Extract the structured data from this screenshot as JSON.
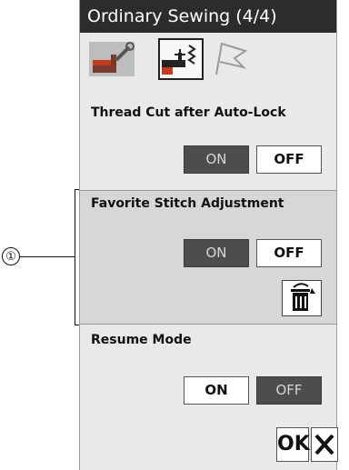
{
  "title": "Ordinary Sewing (4/4)",
  "tabs": [
    {
      "icon": "wrench-machine-icon"
    },
    {
      "icon": "stitch-machine-icon"
    },
    {
      "icon": "flag-icon"
    }
  ],
  "sections": [
    {
      "label": "Thread Cut after Auto-Lock",
      "on": "ON",
      "off": "OFF",
      "selected": "ON"
    },
    {
      "label": "Favorite Stitch Adjustment",
      "on": "ON",
      "off": "OFF",
      "selected": "ON"
    },
    {
      "label": "Resume Mode",
      "on": "ON",
      "off": "OFF",
      "selected": "OFF"
    }
  ],
  "ok_label": "OK",
  "callout": "①",
  "colors": {
    "active": "#4d4d4d",
    "titlebar": "#2c2c2c",
    "panel": "#e9e9e9"
  }
}
